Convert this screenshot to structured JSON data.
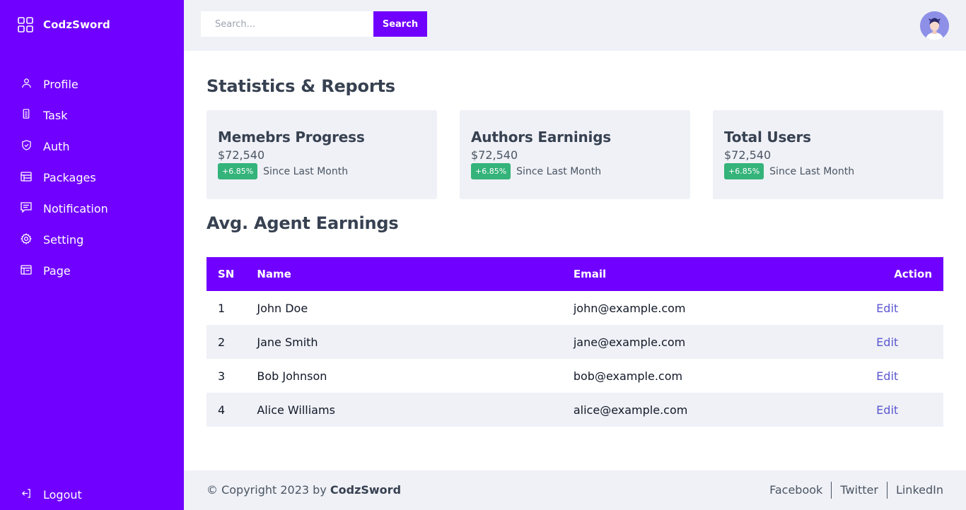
{
  "brand": {
    "name": "CodzSword",
    "icon": "grid-icon"
  },
  "sidebar": {
    "items": [
      {
        "label": "Profile",
        "icon": "user-icon"
      },
      {
        "label": "Task",
        "icon": "document-icon"
      },
      {
        "label": "Auth",
        "icon": "shield-check-icon"
      },
      {
        "label": "Packages",
        "icon": "table-icon"
      },
      {
        "label": "Notification",
        "icon": "message-icon"
      },
      {
        "label": "Setting",
        "icon": "gear-icon"
      },
      {
        "label": "Page",
        "icon": "layout-icon"
      }
    ],
    "logout": {
      "label": "Logout",
      "icon": "logout-icon"
    }
  },
  "topbar": {
    "search_placeholder": "Search...",
    "search_button": "Search"
  },
  "main": {
    "stats_title": "Statistics & Reports",
    "cards": [
      {
        "title": "Memebrs Progress",
        "value": "$72,540",
        "badge": "+6.85%",
        "note": "Since Last Month"
      },
      {
        "title": "Authors Earninigs",
        "value": "$72,540",
        "badge": "+6.85%",
        "note": "Since Last Month"
      },
      {
        "title": "Total Users",
        "value": "$72,540",
        "badge": "+6.85%",
        "note": "Since Last Month"
      }
    ],
    "table_title": "Avg. Agent Earnings",
    "table": {
      "headers": {
        "sn": "SN",
        "name": "Name",
        "email": "Email",
        "action": "Action"
      },
      "rows": [
        {
          "sn": "1",
          "name": "John Doe",
          "email": "john@example.com",
          "action": "Edit"
        },
        {
          "sn": "2",
          "name": "Jane Smith",
          "email": "jane@example.com",
          "action": "Edit"
        },
        {
          "sn": "3",
          "name": "Bob Johnson",
          "email": "bob@example.com",
          "action": "Edit"
        },
        {
          "sn": "4",
          "name": "Alice Williams",
          "email": "alice@example.com",
          "action": "Edit"
        }
      ]
    }
  },
  "footer": {
    "copyright_prefix": "© Copyright 2023 by ",
    "copyright_brand": "CodzSword",
    "links": [
      "Facebook",
      "Twitter",
      "LinkedIn"
    ]
  },
  "colors": {
    "primary": "#7000ff",
    "surface": "#eff1f6",
    "badge": "#34b37a",
    "link": "#5b57d1"
  }
}
